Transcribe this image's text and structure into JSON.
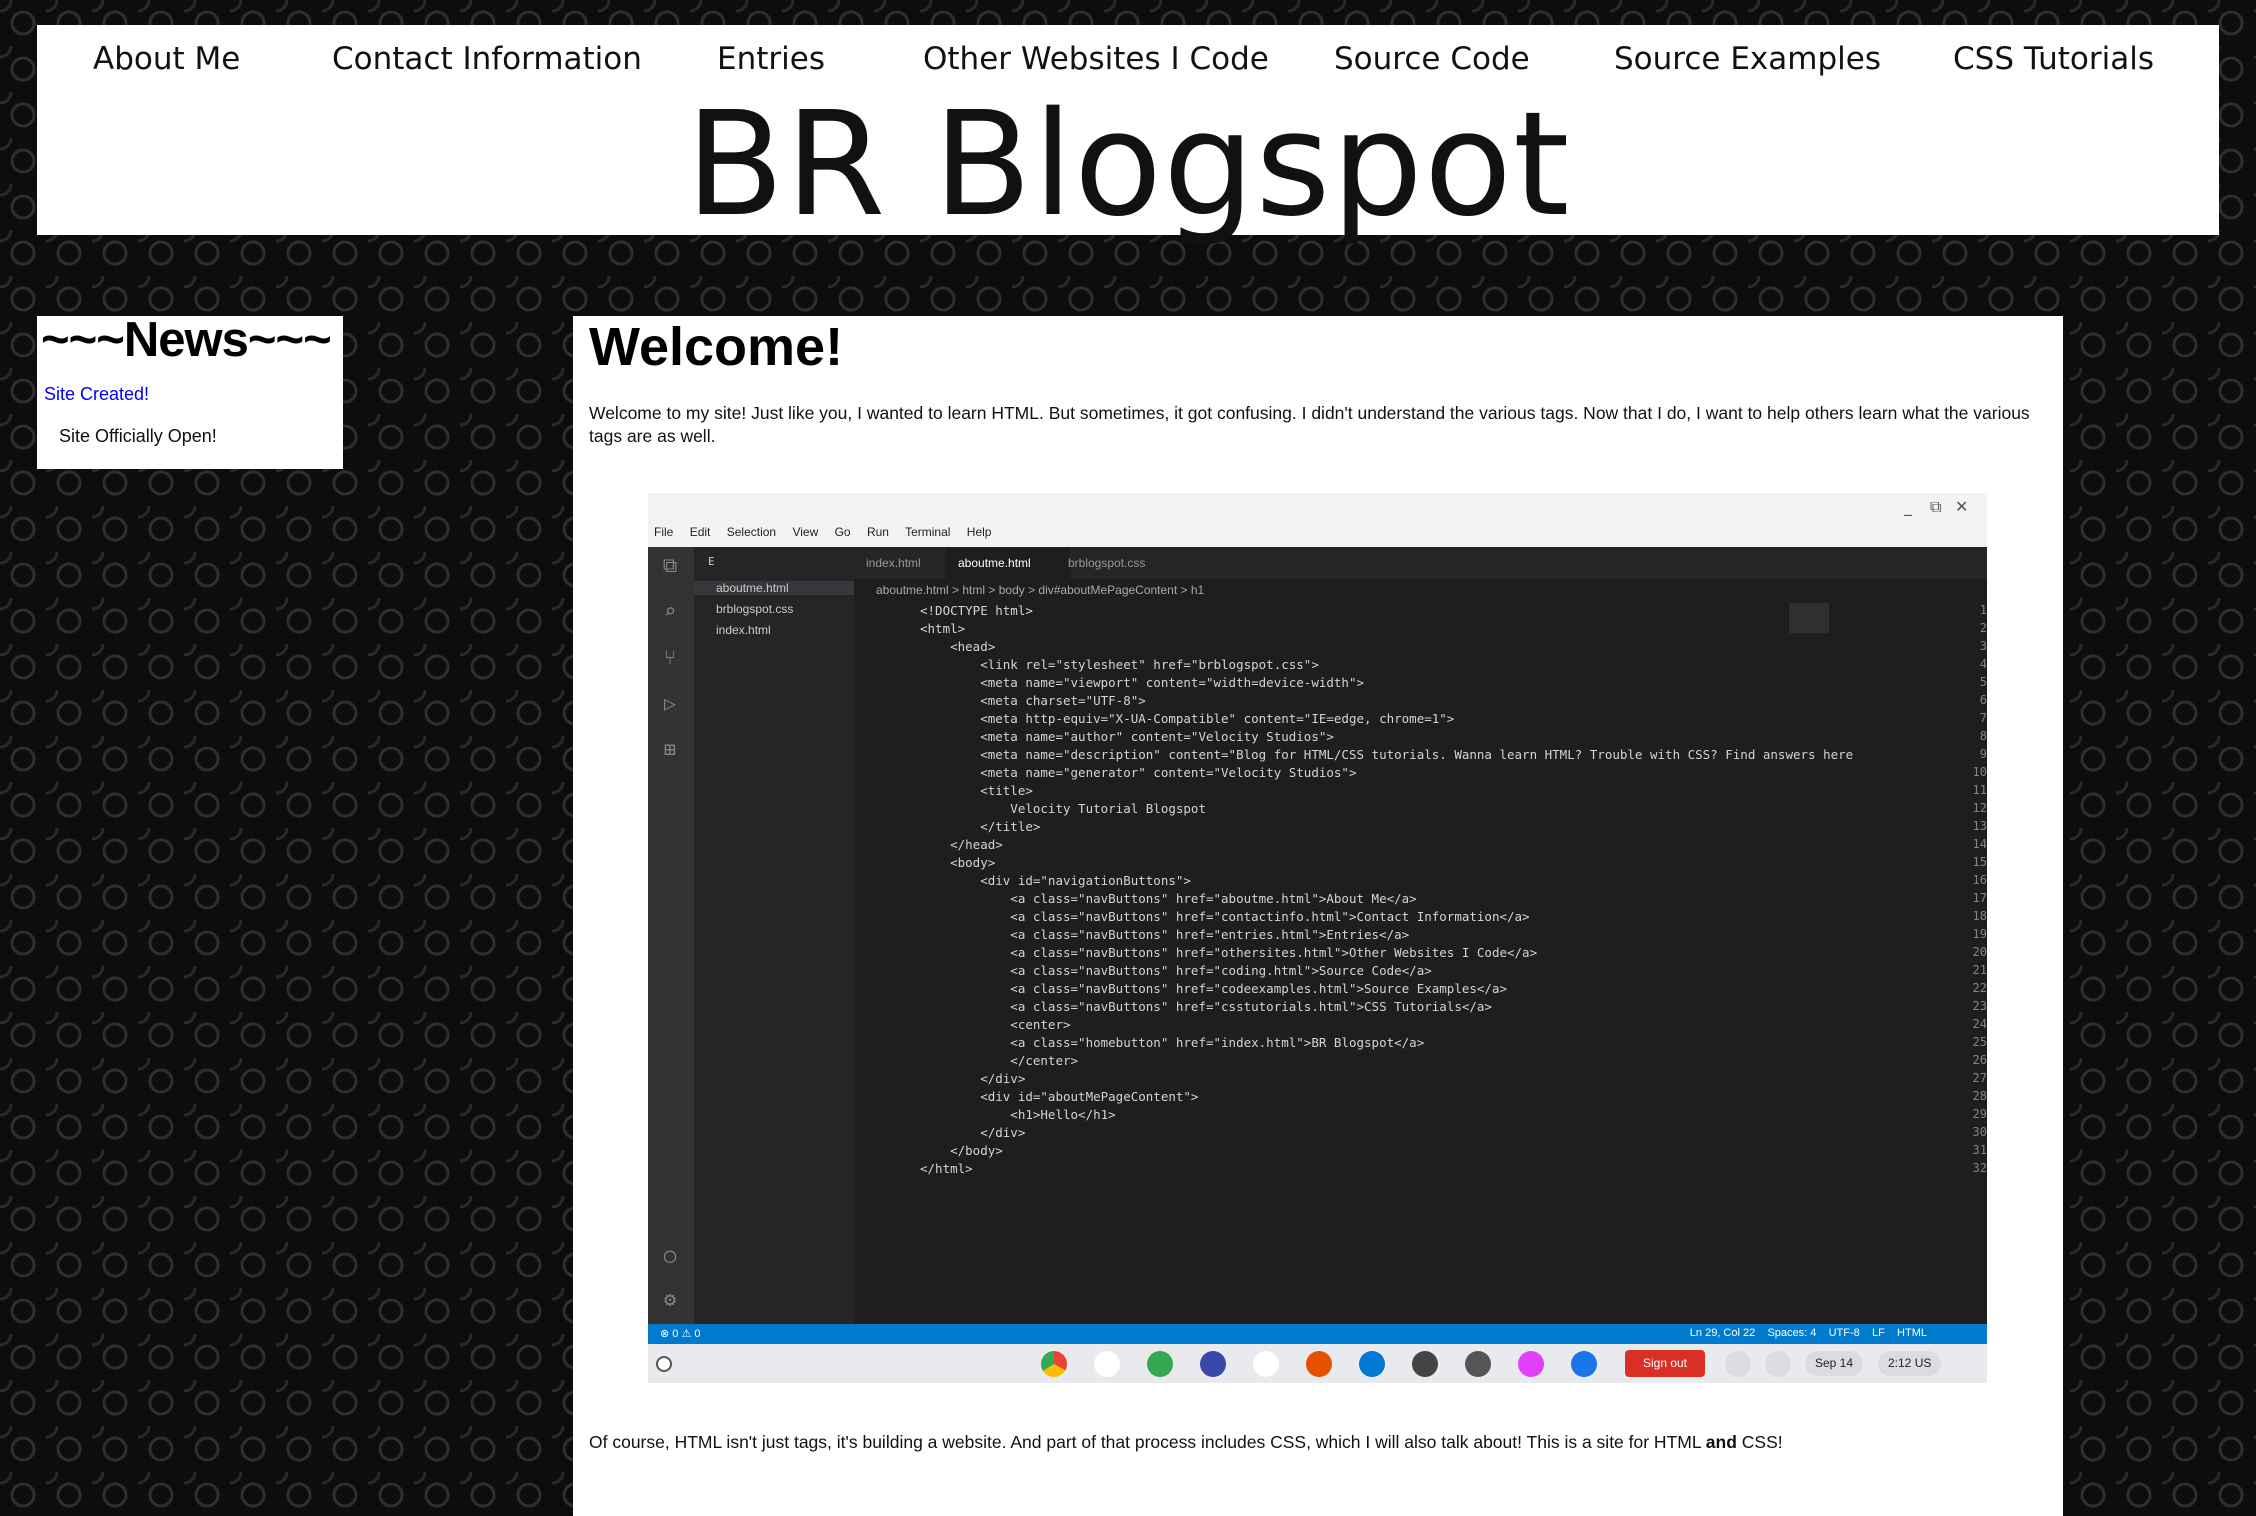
{
  "nav": {
    "items": [
      {
        "label": "About Me"
      },
      {
        "label": "Contact Information"
      },
      {
        "label": "Entries"
      },
      {
        "label": "Other Websites I Code"
      },
      {
        "label": "Source Code"
      },
      {
        "label": "Source Examples"
      },
      {
        "label": "CSS Tutorials"
      }
    ]
  },
  "site": {
    "title": "BR Blogspot"
  },
  "news": {
    "title": "~~~News~~~",
    "link": "Site Created!",
    "item": "Site Officially Open!"
  },
  "content": {
    "title": "Welcome!",
    "intro": "Welcome to my site! Just like you, I wanted to learn HTML. But sometimes, it got confusing. I didn't understand the various tags. Now that I do, I want to help others learn what the various tags are as well.",
    "outro_start": "Of course, HTML isn't just tags, it's building a website. And part of that process includes CSS, which I will also talk about! This is a site for HTML ",
    "outro_bold": "and",
    "outro_end": " CSS!"
  },
  "editor": {
    "window_controls": [
      "_",
      "⧉",
      "✕"
    ],
    "menu": [
      "File",
      "Edit",
      "Selection",
      "View",
      "Go",
      "Run",
      "Terminal",
      "Help"
    ],
    "explorer_letter": "E",
    "files": [
      "aboutme.html",
      "brblogspot.css",
      "index.html"
    ],
    "tabs": [
      "index.html",
      "aboutme.html",
      "brblogspot.css"
    ],
    "breadcrumb": "aboutme.html  >  html  >  body  >  div#aboutMePageContent  >  h1",
    "lines": [
      "<!DOCTYPE html>",
      "<html>",
      "    <head>",
      "        <link rel=\"stylesheet\" href=\"brblogspot.css\">",
      "        <meta name=\"viewport\" content=\"width=device-width\">",
      "        <meta charset=\"UTF-8\">",
      "        <meta http-equiv=\"X-UA-Compatible\" content=\"IE=edge, chrome=1\">",
      "        <meta name=\"author\" content=\"Velocity Studios\">",
      "        <meta name=\"description\" content=\"Blog for HTML/CSS tutorials. Wanna learn HTML? Trouble with CSS? Find answers here",
      "        <meta name=\"generator\" content=\"Velocity Studios\">",
      "        <title>",
      "            Velocity Tutorial Blogspot",
      "        </title>",
      "    </head>",
      "    <body>",
      "        <div id=\"navigationButtons\">",
      "            <a class=\"navButtons\" href=\"aboutme.html\">About Me</a>",
      "            <a class=\"navButtons\" href=\"contactinfo.html\">Contact Information</a>",
      "            <a class=\"navButtons\" href=\"entries.html\">Entries</a>",
      "            <a class=\"navButtons\" href=\"othersites.html\">Other Websites I Code</a>",
      "            <a class=\"navButtons\" href=\"coding.html\">Source Code</a>",
      "            <a class=\"navButtons\" href=\"codeexamples.html\">Source Examples</a>",
      "            <a class=\"navButtons\" href=\"csstutorials.html\">CSS Tutorials</a>",
      "            <center>",
      "            <a class=\"homebutton\" href=\"index.html\">BR Blogspot</a>",
      "            </center>",
      "        </div>",
      "        <div id=\"aboutMePageContent\">",
      "            <h1>Hello</h1>",
      "        </div>",
      "    </body>",
      "</html>"
    ],
    "status_left": "⊗ 0 ⚠ 0",
    "status_right": "Ln 29, Col 22    Spaces: 4    UTF-8    LF    HTML",
    "shelf": {
      "sign_out": "Sign out",
      "date": "Sep 14",
      "time": "2:12 US"
    }
  },
  "colors": {
    "accent": "#007acc",
    "link": "#0000ee",
    "signout": "#d93025"
  }
}
